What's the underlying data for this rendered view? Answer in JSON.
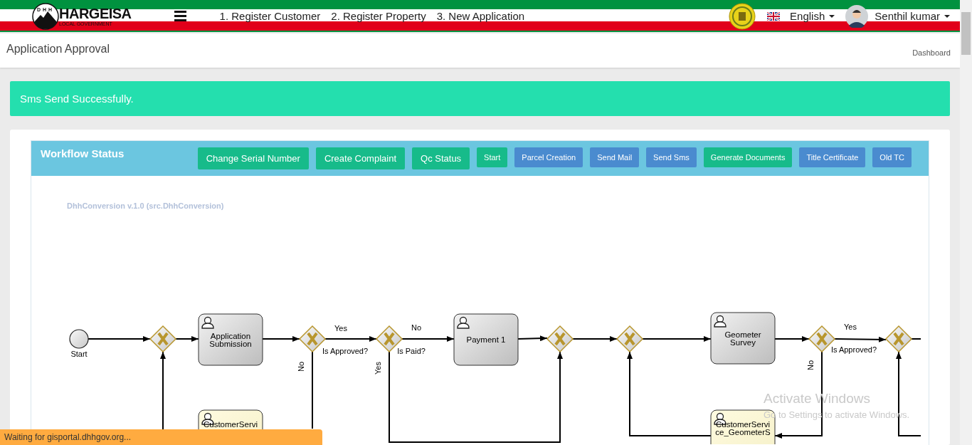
{
  "header": {
    "logo_badge": "DHH",
    "logo_title": "HARGEISA",
    "logo_subtitle": "LOCAL GOVERNMENT",
    "nav_links": [
      "1. Register Customer",
      "2. Register Property",
      "3. New Application"
    ],
    "language": "English",
    "user": "Senthil kumar"
  },
  "page_title": "Application Approval",
  "breadcrumb": "Dashboard",
  "alert": "Sms Send Successfully.",
  "workflow": {
    "title": "Workflow Status",
    "buttons": [
      {
        "label": "Change Serial Number",
        "kind": "large",
        "color": "#17bb8a"
      },
      {
        "label": "Create Complaint",
        "kind": "large",
        "color": "#17bb8a"
      },
      {
        "label": "Qc Status",
        "kind": "large",
        "color": "#17bb8a"
      },
      {
        "label": "Start",
        "kind": "small",
        "color": "#17bb8a"
      },
      {
        "label": "Parcel Creation",
        "kind": "small",
        "color": "#4a8bcf"
      },
      {
        "label": "Send Mail",
        "kind": "small",
        "color": "#4a8bcf"
      },
      {
        "label": "Send Sms",
        "kind": "small",
        "color": "#4a8bcf"
      },
      {
        "label": "Generate Documents",
        "kind": "small",
        "color": "#17bb8a"
      },
      {
        "label": "Title Certificate",
        "kind": "small",
        "color": "#4a8bcf"
      },
      {
        "label": "Old TC",
        "kind": "small",
        "color": "#4a8bcf"
      }
    ],
    "diagram": {
      "title": "DhhConversion v.1.0 (src.DhhConversion)",
      "nodes": [
        {
          "kind": "start",
          "label": "Start"
        },
        {
          "kind": "gateway"
        },
        {
          "kind": "task",
          "lines": [
            "Application",
            "Submission"
          ],
          "highlighted": false
        },
        {
          "kind": "gateway"
        },
        {
          "kind": "gateway"
        },
        {
          "kind": "task",
          "lines": [
            "Payment 1"
          ],
          "highlighted": false
        },
        {
          "kind": "gateway"
        },
        {
          "kind": "gateway"
        },
        {
          "kind": "task",
          "lines": [
            "Geometer",
            "Survey"
          ],
          "highlighted": false
        },
        {
          "kind": "gateway"
        },
        {
          "kind": "gateway"
        },
        {
          "kind": "task",
          "lines": [
            "CustomerServi"
          ],
          "highlighted": true
        },
        {
          "kind": "task",
          "lines": [
            "CustomerServi",
            "ce_GeometerS"
          ],
          "highlighted": true
        }
      ],
      "edge_labels": [
        "Yes",
        "No",
        "Yes",
        "Is Approved?",
        "Is Paid?",
        "Is Approved?",
        "No",
        "Yes",
        "No"
      ]
    }
  },
  "status_bar": "Waiting for gisportal.dhhgov.org...",
  "os_notice": {
    "title": "Activate Windows",
    "subtitle": "Go to Settings to activate Windows."
  }
}
